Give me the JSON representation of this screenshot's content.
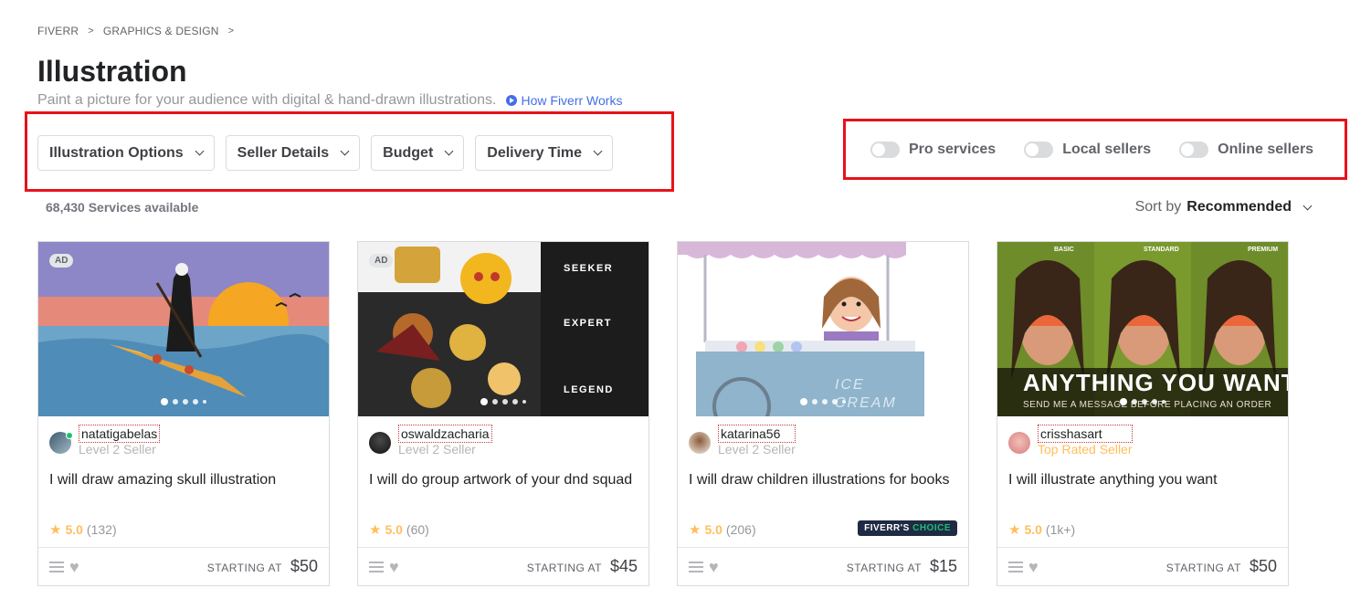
{
  "breadcrumb": {
    "items": [
      "FIVERR",
      "GRAPHICS & DESIGN"
    ],
    "separator": ">"
  },
  "header": {
    "title": "Illustration",
    "subtitle": "Paint a picture for your audience with digital & hand-drawn illustrations.",
    "how_link": "How Fiverr Works"
  },
  "filters": [
    {
      "label": "Illustration Options",
      "icon": "chevron-down-icon"
    },
    {
      "label": "Seller Details",
      "icon": "chevron-down-icon"
    },
    {
      "label": "Budget",
      "icon": "chevron-down-icon"
    },
    {
      "label": "Delivery Time",
      "icon": "chevron-down-icon"
    }
  ],
  "toggles": [
    {
      "label": "Pro services",
      "on": false
    },
    {
      "label": "Local sellers",
      "on": false
    },
    {
      "label": "Online sellers",
      "on": false
    }
  ],
  "results": {
    "count": "68,430 Services available"
  },
  "sort": {
    "prefix": "Sort by",
    "value": "Recommended"
  },
  "gigs": [
    {
      "ad": "AD",
      "seller": "natatigabelas",
      "level": "Level 2 Seller",
      "title": "I will draw amazing skull illustration",
      "rating": "5.0",
      "reviews": "(132)",
      "starting_label": "STARTING AT",
      "price": "$50",
      "online": true
    },
    {
      "ad": "AD",
      "seller": "oswaldzacharia",
      "level": "Level 2 Seller",
      "title": "I will do group artwork of your dnd squad",
      "rating": "5.0",
      "reviews": "(60)",
      "starting_label": "STARTING AT",
      "price": "$45",
      "image_text": [
        "SEEKER",
        "EXPERT",
        "LEGEND"
      ]
    },
    {
      "seller": "katarina56",
      "level": "Level 2 Seller",
      "title": "I will draw children illustrations for books",
      "rating": "5.0",
      "reviews": "(206)",
      "starting_label": "STARTING AT",
      "price": "$15",
      "badge": {
        "brand": "FIVERR'S",
        "word": "CHOICE"
      },
      "image_text": [
        "ICE",
        "CREAM"
      ]
    },
    {
      "seller": "crisshasart",
      "level": "Top Rated Seller",
      "title": "I will illustrate anything you want",
      "rating": "5.0",
      "reviews": "(1k+)",
      "starting_label": "STARTING AT",
      "price": "$50",
      "image_text": [
        "BASIC",
        "STANDARD",
        "PREMIUM",
        "ANYTHING YOU WANT",
        "SEND ME A MESSAGE BEFORE PLACING AN ORDER"
      ]
    }
  ],
  "colors": {
    "brand_green": "#1dbf73",
    "link_blue": "#446ee7",
    "star": "#ffbe5b",
    "highlight_red": "#e8121a"
  }
}
